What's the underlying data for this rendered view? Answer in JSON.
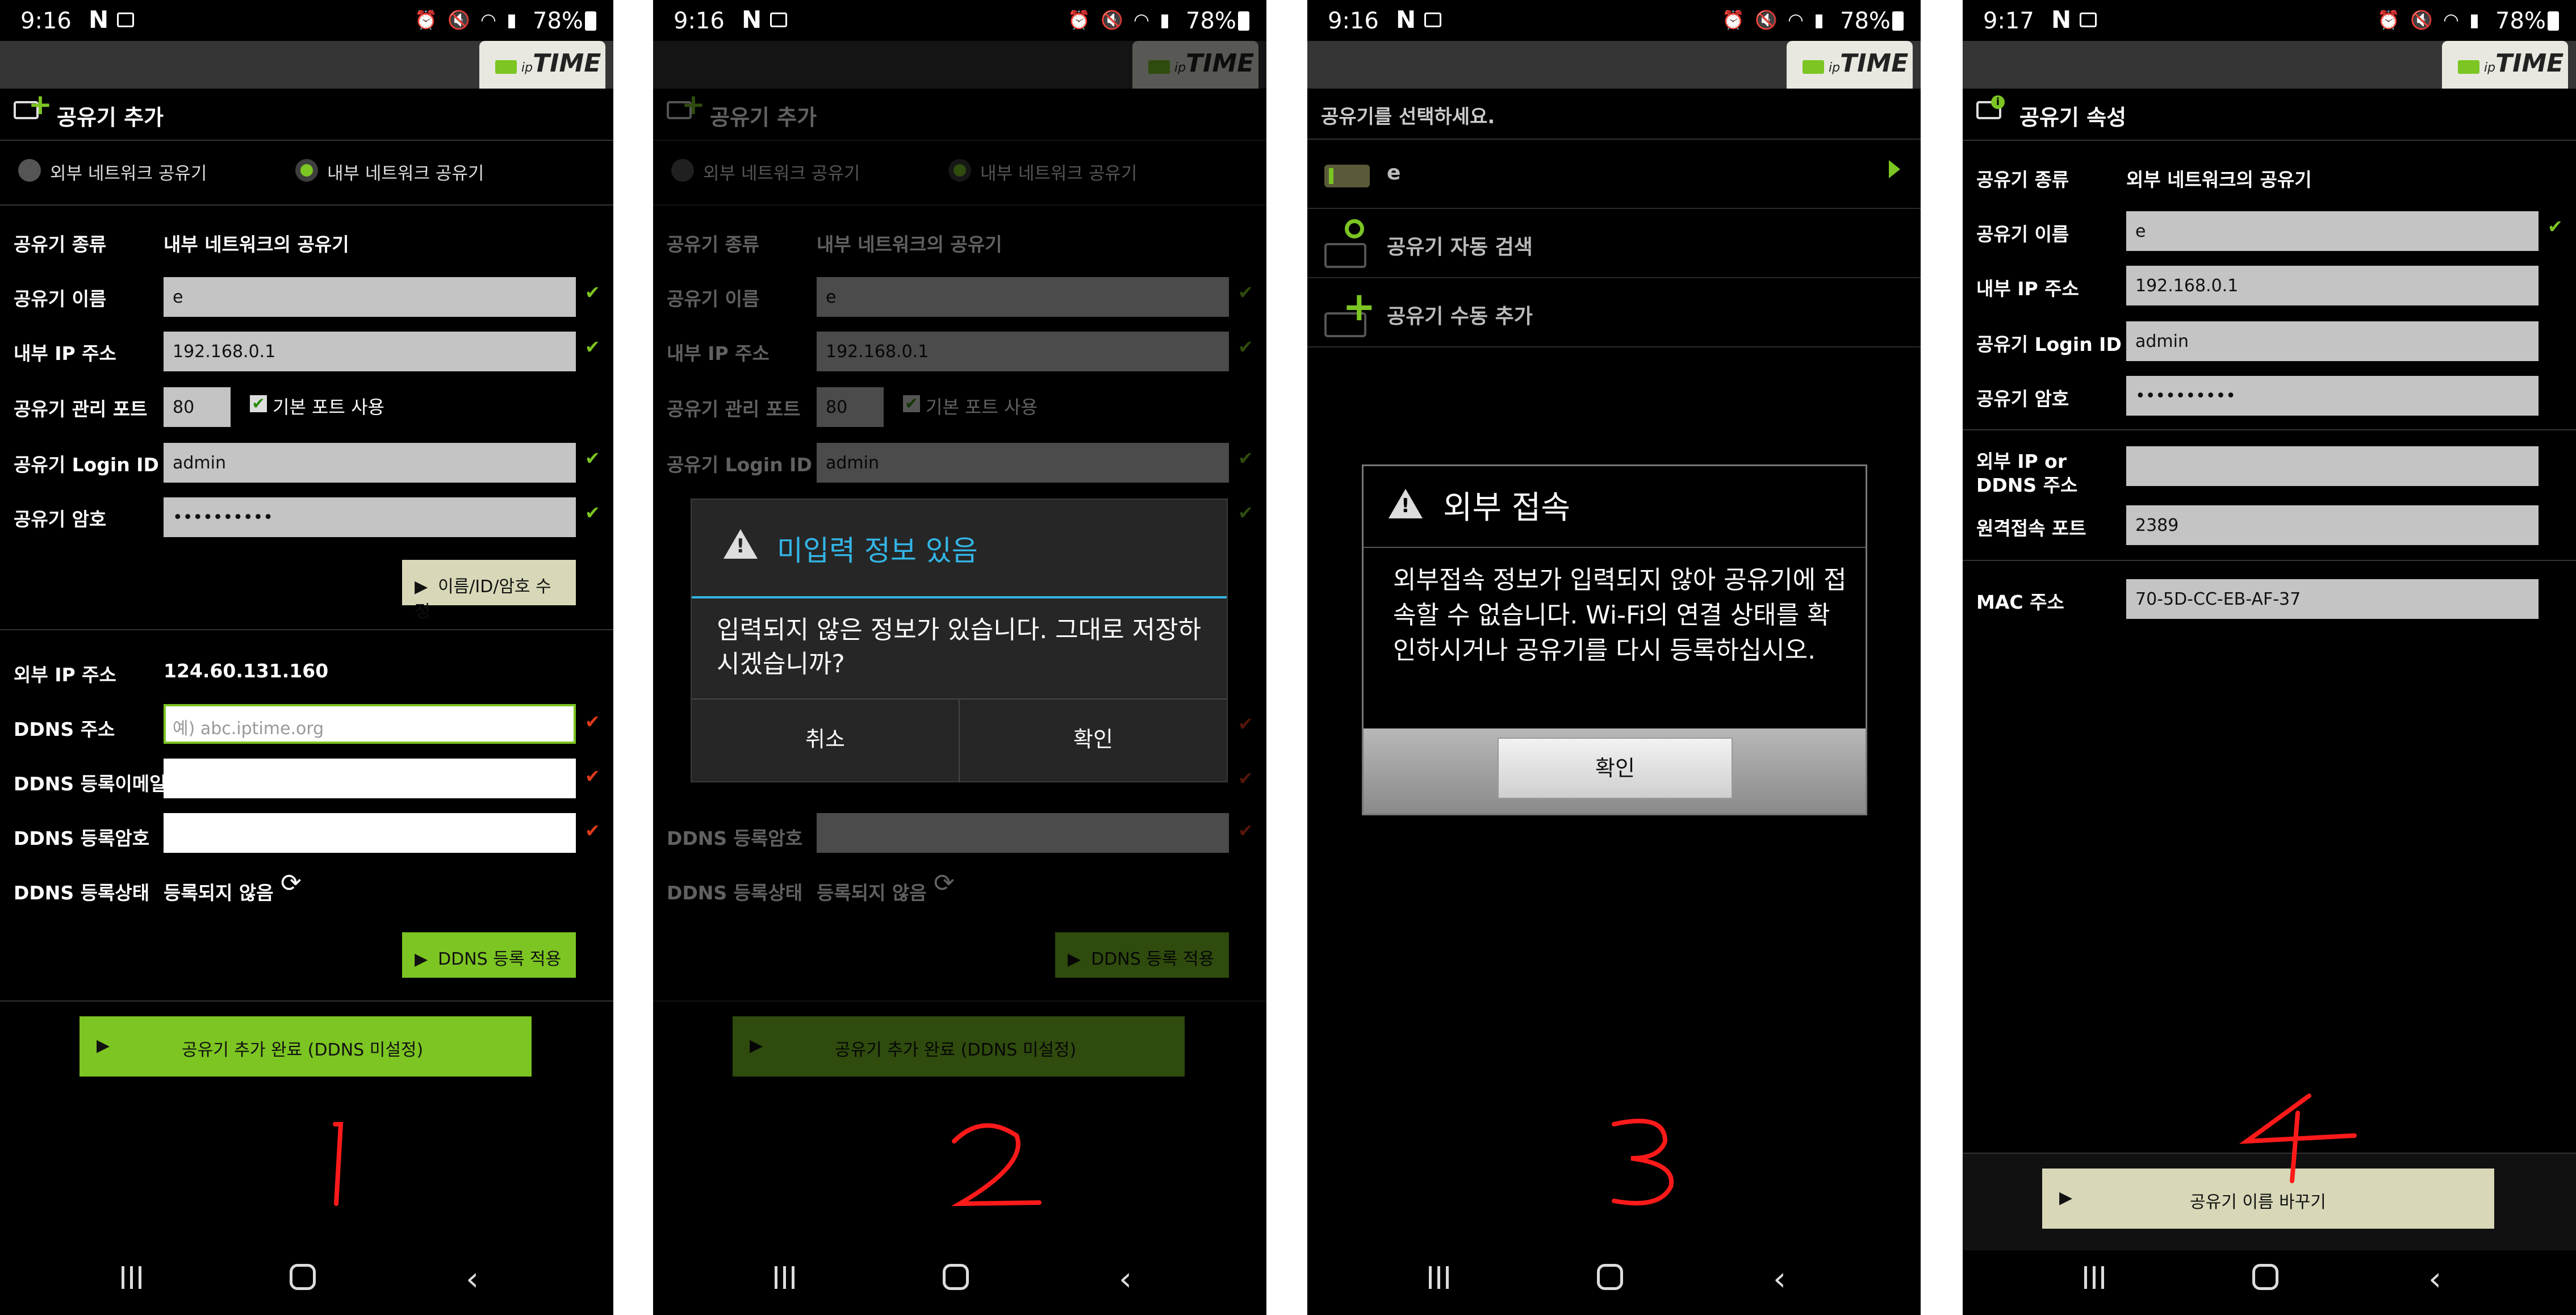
{
  "status": {
    "time1": "9:16",
    "time2": "9:16",
    "time3": "9:16",
    "time4": "9:17",
    "n_icon": "N",
    "battery": "78%"
  },
  "logo": {
    "prefix": "ip",
    "brand": "TIME"
  },
  "p1": {
    "title": "공유기 추가",
    "radio_external": "외부 네트워크 공유기",
    "radio_internal": "내부 네트워크 공유기",
    "type_label": "공유기 종류",
    "type_value": "내부 네트워크의 공유기",
    "name_label": "공유기 이름",
    "name_value": "e",
    "ip_label": "내부 IP 주소",
    "ip_value": "192.168.0.1",
    "port_label": "공유기 관리 포트",
    "port_value": "80",
    "default_port_label": "기본 포트 사용",
    "login_label": "공유기 Login ID",
    "login_value": "admin",
    "pw_label": "공유기 암호",
    "pw_value": "••••••••••",
    "edit_button": "이름/ID/암호 수정",
    "ext_ip_label": "외부 IP 주소",
    "ext_ip_value": "124.60.131.160",
    "ddns_label": "DDNS 주소",
    "ddns_placeholder": "예) abc.iptime.org",
    "ddns_email_label": "DDNS 등록이메일",
    "ddns_pw_label": "DDNS 등록암호",
    "ddns_state_label": "DDNS 등록상태",
    "ddns_state_value": "등록되지 않음",
    "ddns_apply": "DDNS 등록 적용",
    "complete": "공유기 추가 완료 (DDNS 미설정)",
    "hand_number": "1"
  },
  "p2": {
    "dialog_title": "미입력 정보 있음",
    "dialog_message": "입력되지 않은 정보가 있습니다. 그대로 저장하시겠습니까?",
    "cancel": "취소",
    "ok": "확인",
    "hand_number": "2"
  },
  "p3": {
    "title": "공유기를 선택하세요.",
    "items": [
      {
        "label": "e"
      },
      {
        "label": "공유기 자동 검색"
      },
      {
        "label": "공유기 수동 추가"
      }
    ],
    "dialog_title": "외부 접속",
    "dialog_message": "외부접속 정보가 입력되지 않아 공유기에 접속할 수 없습니다. Wi-Fi의 연결 상태를 확인하시거나 공유기를 다시 등록하십시오.",
    "ok": "확인",
    "hand_number": "3"
  },
  "p4": {
    "title": "공유기 속성",
    "type_label": "공유기 종류",
    "type_value": "외부 네트워크의 공유기",
    "name_label": "공유기 이름",
    "name_value": "e",
    "ip_label": "내부 IP 주소",
    "ip_value": "192.168.0.1",
    "login_label": "공유기 Login ID",
    "login_value": "admin",
    "pw_label": "공유기 암호",
    "pw_value": "••••••••••",
    "ext_label_1": "외부 IP or",
    "ext_label_2": "DDNS 주소",
    "ext_value": "",
    "remote_port_label": "원격접속 포트",
    "remote_port_value": "2389",
    "mac_label": "MAC 주소",
    "mac_value": "70-5D-CC-EB-AF-37",
    "rename_button": "공유기 이름 바꾸기",
    "hand_number": "4"
  },
  "colors": {
    "accent_green": "#7cc522",
    "dialog_blue": "#33b5e5",
    "warning_red": "#e03a1a",
    "annotation_red": "#ff1a1a"
  }
}
